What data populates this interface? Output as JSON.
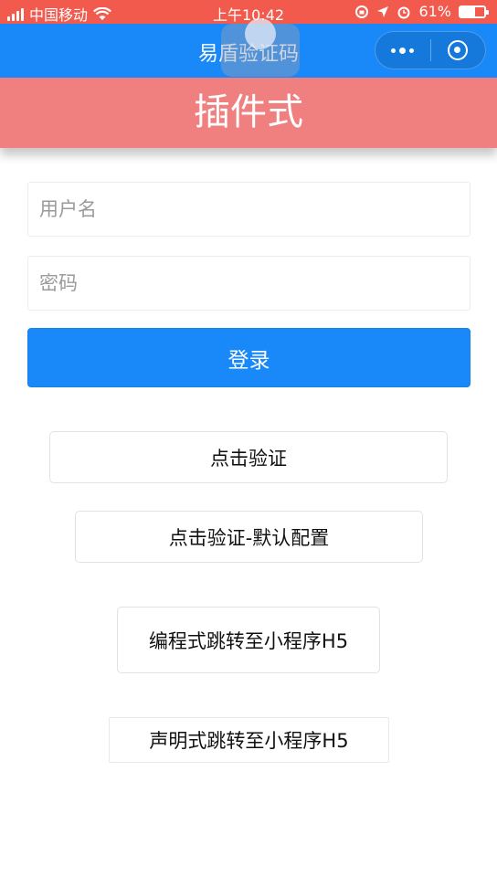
{
  "status_bar": {
    "carrier": "中国移动",
    "time": "上午10:42",
    "battery": "61%",
    "battery_level": 0.61
  },
  "nav": {
    "title": "易盾验证码",
    "more_icon": "more-dots-icon",
    "close_icon": "target-icon"
  },
  "banner": {
    "text": "插件式"
  },
  "form": {
    "username_placeholder": "用户名",
    "password_placeholder": "密码",
    "login_label": "登录"
  },
  "buttons": {
    "click_verify": "点击验证",
    "click_verify_default": "点击验证-默认配置",
    "programmatic_jump": "编程式跳转至小程序H5",
    "declarative_jump": "声明式跳转至小程序H5"
  },
  "colors": {
    "status_bar": "#f25a4d",
    "nav_bar": "#1989fa",
    "banner": "#f08080",
    "primary": "#1989fa"
  }
}
